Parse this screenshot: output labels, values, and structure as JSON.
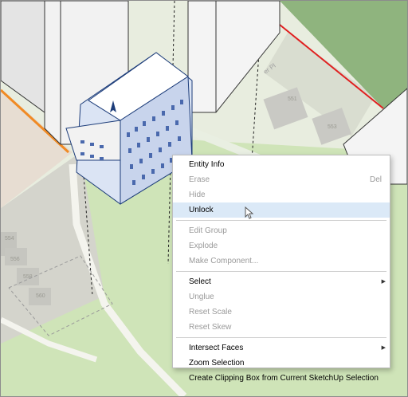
{
  "scene": {
    "street_label": "er Pl",
    "lot_numbers": [
      "551",
      "553",
      "554",
      "556",
      "558",
      "560"
    ]
  },
  "context_menu": {
    "items": [
      {
        "label": "Entity Info",
        "enabled": true
      },
      {
        "label": "Erase",
        "shortcut": "Del",
        "enabled": false
      },
      {
        "label": "Hide",
        "enabled": false
      },
      {
        "label": "Unlock",
        "enabled": true,
        "hover": true
      },
      {
        "separator": true
      },
      {
        "label": "Edit Group",
        "enabled": false
      },
      {
        "label": "Explode",
        "enabled": false
      },
      {
        "label": "Make Component...",
        "enabled": false
      },
      {
        "separator": true
      },
      {
        "label": "Select",
        "enabled": true,
        "submenu": true
      },
      {
        "label": "Unglue",
        "enabled": false
      },
      {
        "label": "Reset Scale",
        "enabled": false
      },
      {
        "label": "Reset Skew",
        "enabled": false
      },
      {
        "separator": true
      },
      {
        "label": "Intersect Faces",
        "enabled": true,
        "submenu": true
      },
      {
        "label": "Zoom Selection",
        "enabled": true
      },
      {
        "label": "Create Clipping Box from Current SketchUp Selection",
        "enabled": true
      }
    ]
  },
  "colors": {
    "menu_hover": "#dbe9f7",
    "grass": "#cde3b4",
    "park": "#8fb47e",
    "building_face": "#f2f2f2",
    "property_line_red": "#e02020",
    "property_line_orange": "#f08a24"
  },
  "icons": {
    "submenu_arrow": "▶",
    "cursor": "arrow-cursor-icon"
  }
}
